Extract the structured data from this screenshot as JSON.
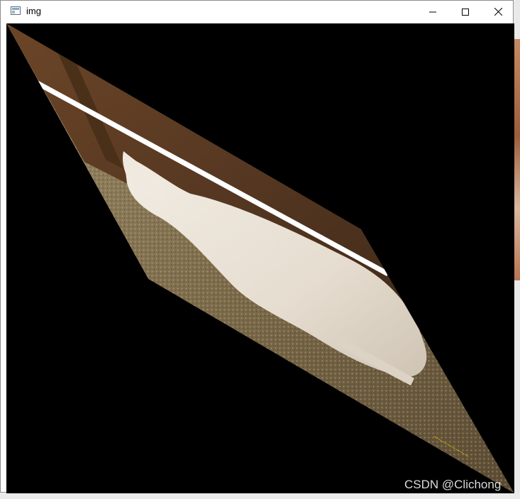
{
  "window": {
    "title": "img",
    "controls": {
      "minimize_icon": "minimize-icon",
      "maximize_icon": "maximize-icon",
      "close_icon": "close-icon"
    }
  },
  "image": {
    "description_icon": "warped-goat-image",
    "colors": {
      "background": "#000000",
      "wall": "#5a3b22",
      "floor": "#8c7a55",
      "goat": "#e9e2d6"
    }
  },
  "watermark": {
    "text": "CSDN @Clichong"
  }
}
